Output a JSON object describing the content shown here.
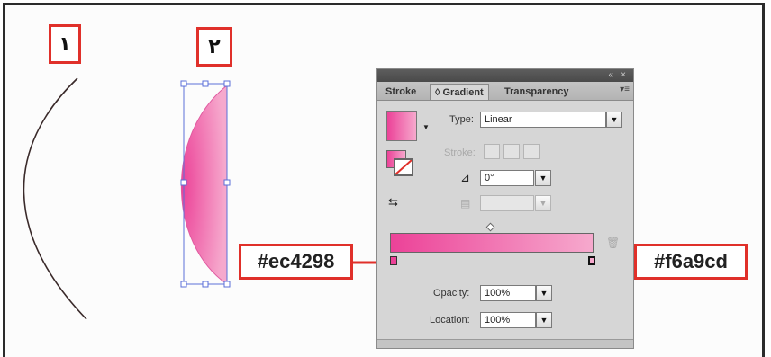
{
  "labels": {
    "step_one": "١",
    "step_two": "٢"
  },
  "callouts": {
    "start_color": "#ec4298",
    "end_color": "#f6a9cd"
  },
  "colors": {
    "callout_border": "#e0302a",
    "gradient_start": "#ec4298",
    "gradient_end": "#f6a9cd",
    "selection": "#5b6fd8"
  },
  "panel": {
    "tabs": [
      {
        "label": "Stroke"
      },
      {
        "label": "◊ Gradient"
      },
      {
        "label": "Transparency"
      }
    ],
    "type_label": "Type:",
    "type_value": "Linear",
    "stroke_label": "Stroke:",
    "angle_value": "0°",
    "opacity_label": "Opacity:",
    "opacity_value": "100%",
    "location_label": "Location:",
    "location_value": "100%"
  }
}
